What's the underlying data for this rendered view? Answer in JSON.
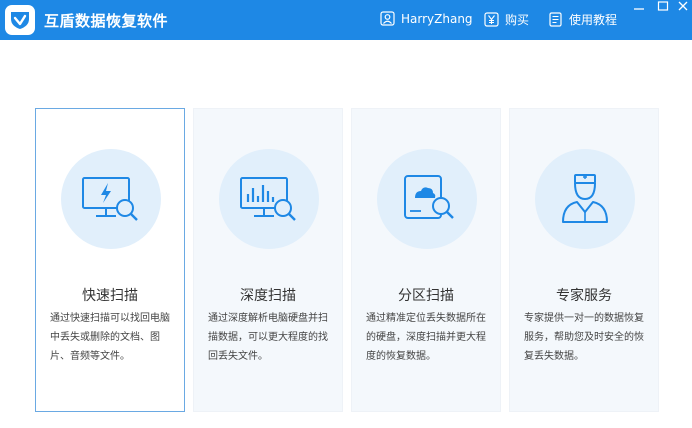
{
  "app": {
    "title": "互盾数据恢复软件"
  },
  "header": {
    "user": "HarryZhang",
    "buy": "购买",
    "tutorial": "使用教程"
  },
  "colors": {
    "titlebar": "#1e88e5",
    "icon": "#1e88e5",
    "active_border": "#6aa9e3"
  },
  "cards": [
    {
      "title": "快速扫描",
      "desc": "通过快速扫描可以找回电脑中丢失或删除的文档、图片、音频等文件。",
      "icon": "monitor-lightning-search-icon",
      "active": true
    },
    {
      "title": "深度扫描",
      "desc": "通过深度解析电脑硬盘并扫描数据，可以更大程度的找回丢失文件。",
      "icon": "monitor-chart-search-icon",
      "active": false
    },
    {
      "title": "分区扫描",
      "desc": "通过精准定位丢失数据所在的硬盘，深度扫描并更大程度的恢复数据。",
      "icon": "disk-cloud-search-icon",
      "active": false
    },
    {
      "title": "专家服务",
      "desc": "专家提供一对一的数据恢复服务，帮助您及时安全的恢复丢失数据。",
      "icon": "expert-doctor-icon",
      "active": false
    }
  ]
}
